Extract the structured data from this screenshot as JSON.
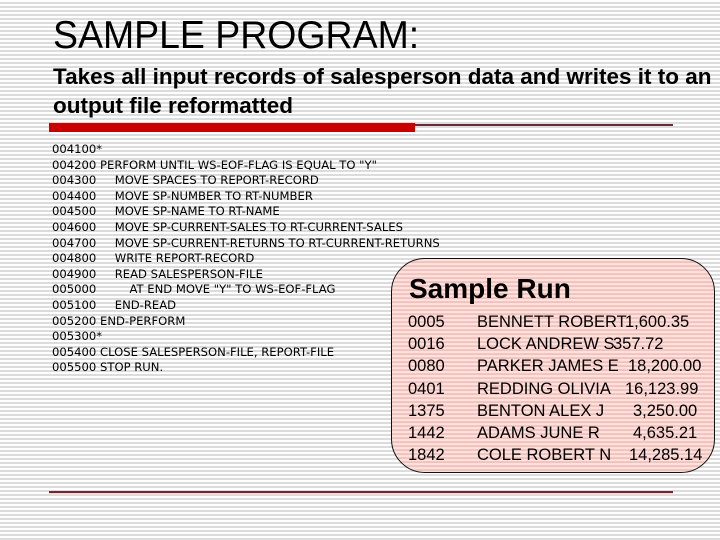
{
  "slide": {
    "title": "SAMPLE PROGRAM:",
    "subtitle": "Takes all input records of salesperson data and writes it to an output file reformatted",
    "accent_color": "#c80000",
    "rule_color": "#6b2a33"
  },
  "code": {
    "lines": [
      {
        "num": "004100*",
        "text": ""
      },
      {
        "num": "004200",
        "text": "PERFORM UNTIL WS-EOF-FLAG IS EQUAL TO \"Y\""
      },
      {
        "num": "004300",
        "text": "    MOVE SPACES TO REPORT-RECORD"
      },
      {
        "num": "004400",
        "text": "    MOVE SP-NUMBER TO RT-NUMBER"
      },
      {
        "num": "004500",
        "text": "    MOVE SP-NAME TO RT-NAME"
      },
      {
        "num": "004600",
        "text": "    MOVE SP-CURRENT-SALES TO RT-CURRENT-SALES"
      },
      {
        "num": "004700",
        "text": "    MOVE SP-CURRENT-RETURNS TO RT-CURRENT-RETURNS"
      },
      {
        "num": "004800",
        "text": "    WRITE REPORT-RECORD"
      },
      {
        "num": "004900",
        "text": "    READ SALESPERSON-FILE"
      },
      {
        "num": "005000",
        "text": "        AT END MOVE \"Y\" TO WS-EOF-FLAG"
      },
      {
        "num": "005100",
        "text": "    END-READ"
      },
      {
        "num": "005200",
        "text": "END-PERFORM"
      },
      {
        "num": "005300*",
        "text": ""
      },
      {
        "num": "005400",
        "text": "CLOSE SALESPERSON-FILE, REPORT-FILE"
      },
      {
        "num": "005500",
        "text": "STOP RUN."
      }
    ]
  },
  "sample_run": {
    "title": "Sample Run",
    "background_color": "#fcd8d3",
    "rows": [
      {
        "id": "0005",
        "name": "BENNETT ROBERT",
        "amount": "1,600.35"
      },
      {
        "id": "0016",
        "name": "LOCK ANDREW S",
        "amount": "357.72"
      },
      {
        "id": "0080",
        "name": "PARKER JAMES E",
        "amount": "18,200.00"
      },
      {
        "id": "0401",
        "name": "REDDING OLIVIA",
        "amount": "16,123.99"
      },
      {
        "id": "1375",
        "name": "BENTON ALEX J",
        "amount": "3,250.00"
      },
      {
        "id": "1442",
        "name": "ADAMS JUNE R",
        "amount": "4,635.21"
      },
      {
        "id": "1842",
        "name": "COLE ROBERT N",
        "amount": "14,285.14"
      }
    ]
  }
}
